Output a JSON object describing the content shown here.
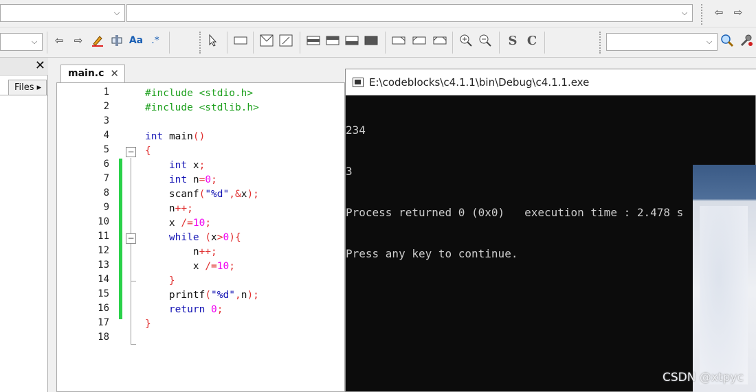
{
  "toolbar": {
    "target_combo_value": "",
    "function_combo_value": "",
    "search_combo_value": "",
    "search_combo2_value": ""
  },
  "left_panel": {
    "files_tab_label": "Files ▸"
  },
  "editor": {
    "tab_label": "main.c",
    "tab_close": "✕",
    "line_numbers": [
      "1",
      "2",
      "3",
      "4",
      "5",
      "6",
      "7",
      "8",
      "9",
      "10",
      "11",
      "12",
      "13",
      "14",
      "15",
      "16",
      "17",
      "18"
    ]
  },
  "console": {
    "title": "E:\\codeblocks\\c4.1.1\\bin\\Debug\\c4.1.1.exe",
    "lines": [
      "234",
      "3",
      "Process returned 0 (0x0)   execution time : 2.478 s",
      "Press any key to continue."
    ]
  },
  "watermark": "CSDN @xtpyc",
  "icons": [
    "jump-back-icon",
    "jump-forward-icon",
    "highlight-icon",
    "select-icon",
    "match-case-icon",
    "regex-icon",
    "pointer-icon",
    "block-icon",
    "comment-icon",
    "uncomment-icon",
    "zoom-in-icon",
    "zoom-out-icon",
    "symbol-s-icon",
    "symbol-c-icon",
    "search-go-icon",
    "settings-wrench-icon",
    "close-icon"
  ],
  "colors": {
    "preprocessor": "#1ea01e",
    "keyword": "#1414b4",
    "number": "#f000f0",
    "operator": "#e03030",
    "changed_bar": "#2ad14a",
    "console_bg": "#0c0c0c",
    "console_fg": "#cccccc"
  }
}
